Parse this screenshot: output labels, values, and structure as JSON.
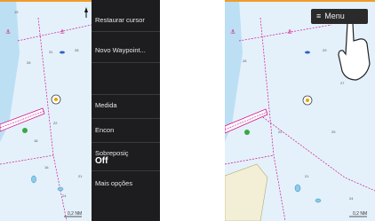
{
  "side_menu": {
    "items": [
      {
        "label": "Restaurar cursor"
      },
      {
        "label": "Novo Waypoint..."
      },
      {
        "label": ""
      },
      {
        "label": "Medida"
      },
      {
        "label": "Encon"
      },
      {
        "label": "Sobreposiç",
        "value": "Off"
      },
      {
        "label": "Mais opções"
      }
    ]
  },
  "left_chart": {
    "scale": "0,2 NM"
  },
  "right_chart": {
    "scale": "0,2 NM",
    "menu_button": {
      "icon": "≡",
      "label": "Menu"
    }
  },
  "icons": [
    "north-arrow-icon",
    "anchor-icon",
    "swipe-arrow-icon",
    "hand-gesture-icon",
    "wreck-icon",
    "tap-hand-icon"
  ],
  "colors": {
    "sea": "#e4f1fb",
    "shallow": "#bcdff4",
    "land": "#f3efd7",
    "menu_bg": "#1d1d1f",
    "arrow": "#2e86c1",
    "magenta": "#d0158e"
  }
}
